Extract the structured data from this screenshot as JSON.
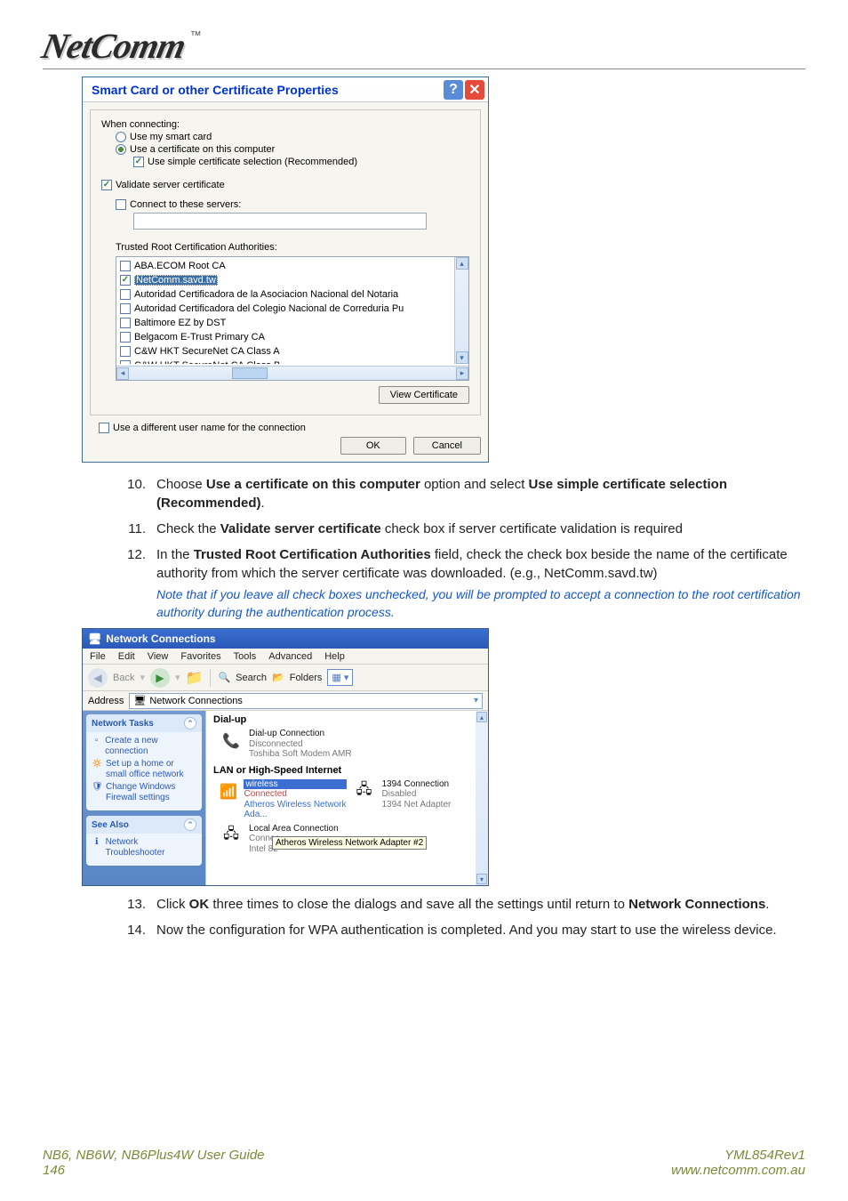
{
  "header": {
    "logo": "NetComm",
    "tm": "™"
  },
  "dialog1": {
    "title": "Smart Card or other Certificate Properties",
    "when_connecting": "When connecting:",
    "opt_smartcard": "Use my smart card",
    "opt_cert": "Use a certificate on this computer",
    "opt_simple": "Use simple certificate selection (Recommended)",
    "validate": "Validate server certificate",
    "connect_servers": "Connect to these servers:",
    "trusted_label": "Trusted Root Certification Authorities:",
    "ca": [
      {
        "label": "ABA.ECOM Root CA",
        "checked": false,
        "selected": false
      },
      {
        "label": "NetComm.savd.tw",
        "checked": true,
        "selected": true
      },
      {
        "label": "Autoridad Certificadora de la Asociacion Nacional del Notaria",
        "checked": false,
        "selected": false
      },
      {
        "label": "Autoridad Certificadora del Colegio Nacional de Correduria Pu",
        "checked": false,
        "selected": false
      },
      {
        "label": "Baltimore EZ by DST",
        "checked": false,
        "selected": false
      },
      {
        "label": "Belgacom E-Trust Primary CA",
        "checked": false,
        "selected": false
      },
      {
        "label": "C&W HKT SecureNet CA Class A",
        "checked": false,
        "selected": false
      },
      {
        "label": "C&W HKT SecureNet CA Class B",
        "checked": false,
        "selected": false
      }
    ],
    "view_cert": "View Certificate",
    "diff_user": "Use a different user name for the connection",
    "ok": "OK",
    "cancel": "Cancel"
  },
  "instructions": {
    "i10_num": "10.",
    "i10_a": "Choose ",
    "i10_b": "Use a certificate on this computer",
    "i10_c": " option and select ",
    "i10_d": "Use simple certificate selection (Recommended)",
    "i10_e": ".",
    "i11_num": "11.",
    "i11_a": "Check the ",
    "i11_b": "Validate server certificate",
    "i11_c": " check box if server certificate validation is required",
    "i12_num": "12.",
    "i12_a": "In the ",
    "i12_b": "Trusted Root Certification Authorities",
    "i12_c": " field, check the check box beside the name of the certificate authority from which the server certificate was downloaded. (e.g., NetComm.savd.tw)",
    "i12_note": "Note that if you leave all check boxes unchecked, you will be prompted to accept a connection to the root certification authority during the authentication process.",
    "i13_num": "13.",
    "i13_a": "Click ",
    "i13_b": "OK",
    "i13_c": " three times to close the dialogs and save all the settings until return to ",
    "i13_d": "Network Connections",
    "i13_e": ".",
    "i14_num": "14.",
    "i14_a": "Now the configuration for WPA authentication is completed. And you may start to use the wireless device."
  },
  "dialog2": {
    "title": "Network Connections",
    "menu": [
      "File",
      "Edit",
      "View",
      "Favorites",
      "Tools",
      "Advanced",
      "Help"
    ],
    "tb": {
      "back": "Back",
      "search": "Search",
      "folders": "Folders"
    },
    "addr_label": "Address",
    "addr_value": "Network Connections",
    "side": {
      "tasks_title": "Network Tasks",
      "tasks": [
        {
          "label": "Create a new connection"
        },
        {
          "label": "Set up a home or small office network"
        },
        {
          "label": "Change Windows Firewall settings"
        }
      ],
      "seealso_title": "See Also",
      "seealso": [
        {
          "label": "Network Troubleshooter"
        }
      ]
    },
    "content": {
      "dialup_h": "Dial-up",
      "dialup": {
        "name": "Dial-up Connection",
        "status": "Disconnected",
        "sub": "Toshiba Soft Modem AMR"
      },
      "lan_h": "LAN or High-Speed Internet",
      "wireless": {
        "name": "wireless",
        "status": "Connected",
        "sub": "Atheros Wireless Network Ada..."
      },
      "c1394": {
        "name": "1394 Connection",
        "status": "Disabled",
        "sub": "1394 Net Adapter"
      },
      "lac": {
        "name": "Local Area Connection",
        "status": "Connec",
        "sub": "Intel 82"
      },
      "tooltip": "Atheros Wireless Network Adapter #2"
    }
  },
  "footer": {
    "left1": "NB6, NB6W, NB6Plus4W User Guide",
    "left2": "146",
    "right1": "YML854Rev1",
    "right2": "www.netcomm.com.au"
  }
}
